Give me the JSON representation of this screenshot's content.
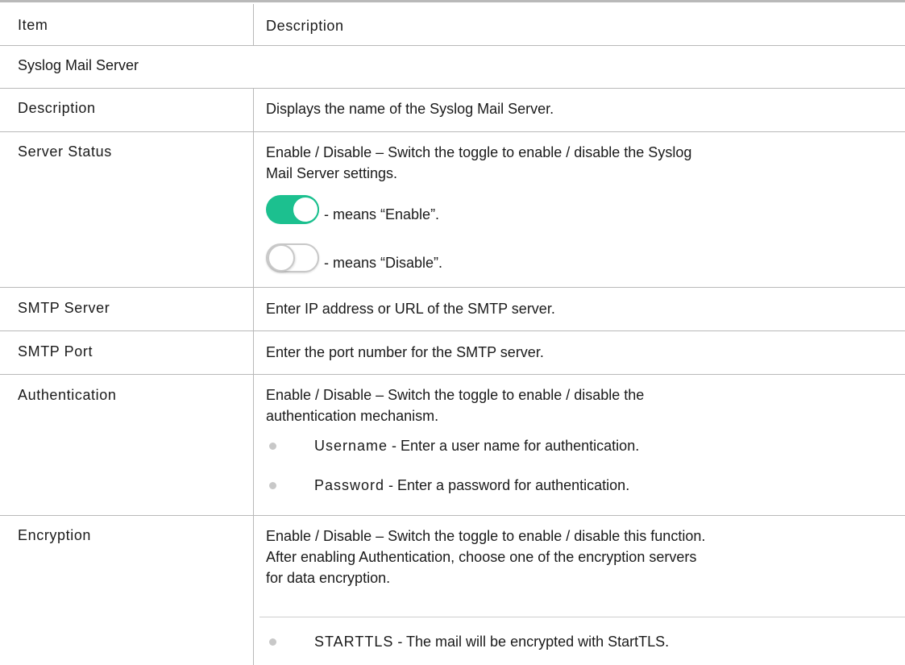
{
  "header": {
    "item": "Item",
    "description": "Description"
  },
  "section_title": "Syslog Mail Server",
  "rows": {
    "description": {
      "item": "Description",
      "text": "Displays the name of the Syslog Mail Server."
    },
    "server_status": {
      "item": "Server Status",
      "line1": "Enable / Disable – Switch the toggle to enable / disable the Syslog",
      "line2": "Mail Server settings.",
      "enable_text": "- means “Enable”.",
      "disable_text": "- means “Disable”."
    },
    "smtp_server": {
      "item": "SMTP Server",
      "text": "Enter IP address or URL of the SMTP server."
    },
    "smtp_port": {
      "item": "SMTP Port",
      "text": "Enter the port number for the SMTP server."
    },
    "authentication": {
      "item": "Authentication",
      "line1": "Enable / Disable – Switch the toggle to enable / disable the",
      "line2": "authentication mechanism.",
      "bullets": [
        {
          "term": "Username",
          "text": " - Enter a user name for authentication."
        },
        {
          "term": "Password",
          "text": " - Enter a password for authentication."
        }
      ]
    },
    "encryption": {
      "item": "Encryption",
      "line1": "Enable / Disable – Switch the toggle to enable / disable this function.",
      "line2": "After enabling Authentication, choose one of the encryption servers",
      "line3": "for data encryption.",
      "bullets": [
        {
          "term": "STARTTLS",
          "text": " - The mail will be encrypted with StartTLS."
        }
      ]
    }
  },
  "colors": {
    "toggle_on": "#1cc08f",
    "toggle_off_border": "#c8c8c8",
    "rule": "#b9b9b9"
  }
}
